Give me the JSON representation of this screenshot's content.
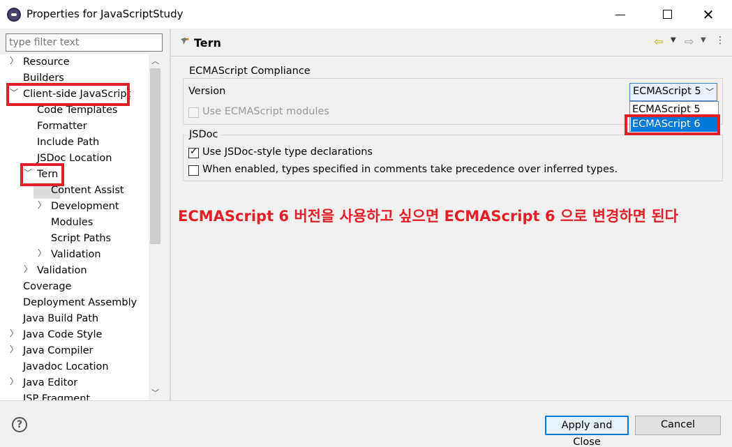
{
  "window": {
    "title": "Properties for JavaScriptStudy",
    "minimize": "minimize",
    "maximize": "maximize",
    "close": "✕"
  },
  "filter": {
    "placeholder": "type filter text"
  },
  "tree": {
    "items": [
      {
        "label": "Resource",
        "chevron": "collapsed"
      },
      {
        "label": "Builders",
        "chevron": "none"
      },
      {
        "label": "Client-side JavaScript",
        "chevron": "expanded"
      },
      {
        "label": "Code Templates",
        "chevron": "none"
      },
      {
        "label": "Formatter",
        "chevron": "none"
      },
      {
        "label": "Include Path",
        "chevron": "none"
      },
      {
        "label": "JSDoc Location",
        "chevron": "none"
      },
      {
        "label": "Tern",
        "chevron": "expanded"
      },
      {
        "label": "Content Assist",
        "chevron": "none"
      },
      {
        "label": "Development",
        "chevron": "collapsed"
      },
      {
        "label": "Modules",
        "chevron": "none"
      },
      {
        "label": "Script Paths",
        "chevron": "none"
      },
      {
        "label": "Validation",
        "chevron": "collapsed"
      },
      {
        "label": "Validation",
        "chevron": "collapsed"
      },
      {
        "label": "Coverage",
        "chevron": "none"
      },
      {
        "label": "Deployment Assembly",
        "chevron": "none"
      },
      {
        "label": "Java Build Path",
        "chevron": "none"
      },
      {
        "label": "Java Code Style",
        "chevron": "collapsed"
      },
      {
        "label": "Java Compiler",
        "chevron": "collapsed"
      },
      {
        "label": "Javadoc Location",
        "chevron": "none"
      },
      {
        "label": "Java Editor",
        "chevron": "collapsed"
      },
      {
        "label": "JSP Fragment",
        "chevron": "none"
      }
    ],
    "selected": "Tern"
  },
  "page": {
    "title": "Tern",
    "ecma_group": {
      "label": "ECMAScript Compliance",
      "version_label": "Version",
      "version_value": "ECMAScript 5",
      "modules_label": "Use ECMAScript modules",
      "modules_checked": false,
      "modules_enabled": false,
      "options": [
        "ECMAScript 5",
        "ECMAScript 6"
      ],
      "highlighted_option": "ECMAScript 6"
    },
    "jsdoc_group": {
      "label": "JSDoc",
      "use_jsdoc_label": "Use JSDoc-style type declarations",
      "use_jsdoc_checked": true,
      "precedence_label": "When enabled, types specified in comments take precedence over inferred types.",
      "precedence_checked": false
    },
    "note": "ECMAScript 6 버전을 사용하고 싶으면 ECMAScript 6 으로 변경하면 된다"
  },
  "buttons": {
    "help": "?",
    "apply_close": "Apply and Close",
    "cancel": "Cancel"
  },
  "colors": {
    "highlight_red": "#e01f26",
    "selection_blue": "#0078d7"
  }
}
